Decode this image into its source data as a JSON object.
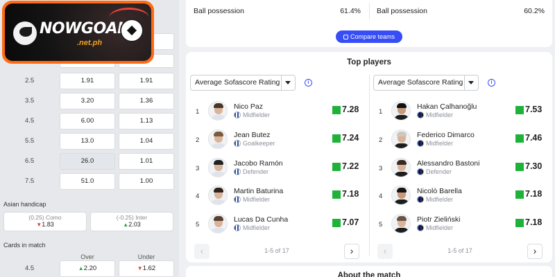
{
  "logo": {
    "word": "NOWGOAL",
    "sub": ".net.ph"
  },
  "odds_rows": [
    {
      "line": "2.5",
      "over": "1.91",
      "under": "1.91",
      "selected": false
    },
    {
      "line": "3.5",
      "over": "3.20",
      "under": "1.36",
      "selected": false
    },
    {
      "line": "4.5",
      "over": "6.00",
      "under": "1.13",
      "selected": false
    },
    {
      "line": "5.5",
      "over": "13.0",
      "under": "1.04",
      "selected": false
    },
    {
      "line": "6.5",
      "over": "26.0",
      "under": "1.01",
      "selected": true
    },
    {
      "line": "7.5",
      "over": "51.0",
      "under": "1.00",
      "selected": false
    }
  ],
  "asian_handicap": {
    "label": "Asian handicap",
    "home": {
      "team": "(0.25) Como",
      "odds": "1.83",
      "trend": "down"
    },
    "away": {
      "team": "(-0.25) Inter",
      "odds": "2.03",
      "trend": "up"
    }
  },
  "cards": {
    "label": "Cards in match",
    "over_label": "Over",
    "under_label": "Under",
    "line": "4.5",
    "over": "2.20",
    "over_trend": "up",
    "under": "1.62",
    "under_trend": "down"
  },
  "possession": {
    "left_label": "Ball possession",
    "left_value": "61.4%",
    "right_label": "Ball possession",
    "right_value": "60.2%",
    "compare_button": "Compare teams"
  },
  "top_players": {
    "title": "Top players",
    "home": {
      "dropdown": "Average Sofascore Rating",
      "pager": "1-5 of 17",
      "players": [
        {
          "rank": "1",
          "name": "Nico Paz",
          "position": "Midfielder",
          "rating": "7.28"
        },
        {
          "rank": "2",
          "name": "Jean Butez",
          "position": "Goalkeeper",
          "rating": "7.24"
        },
        {
          "rank": "3",
          "name": "Jacobo Ramón",
          "position": "Defender",
          "rating": "7.22"
        },
        {
          "rank": "4",
          "name": "Martin Baturina",
          "position": "Midfielder",
          "rating": "7.18"
        },
        {
          "rank": "5",
          "name": "Lucas Da Cunha",
          "position": "Midfielder",
          "rating": "7.07"
        }
      ]
    },
    "away": {
      "dropdown": "Average Sofascore Rating",
      "pager": "1-5 of 17",
      "players": [
        {
          "rank": "1",
          "name": "Hakan Çalhanoğlu",
          "position": "Midfielder",
          "rating": "7.53"
        },
        {
          "rank": "2",
          "name": "Federico Dimarco",
          "position": "Midfielder",
          "rating": "7.46"
        },
        {
          "rank": "3",
          "name": "Alessandro Bastoni",
          "position": "Defender",
          "rating": "7.30"
        },
        {
          "rank": "4",
          "name": "Nicolò Barella",
          "position": "Midfielder",
          "rating": "7.18"
        },
        {
          "rank": "5",
          "name": "Piotr Zieliński",
          "position": "Midfielder",
          "rating": "7.18"
        }
      ]
    }
  },
  "about": {
    "title": "About the match"
  },
  "colors": {
    "accent": "#374df5",
    "rating_good": "#1fb23a",
    "logo_frame": "#ff6a14",
    "odds_up": "#2b9d48",
    "odds_down": "#d1443b"
  }
}
